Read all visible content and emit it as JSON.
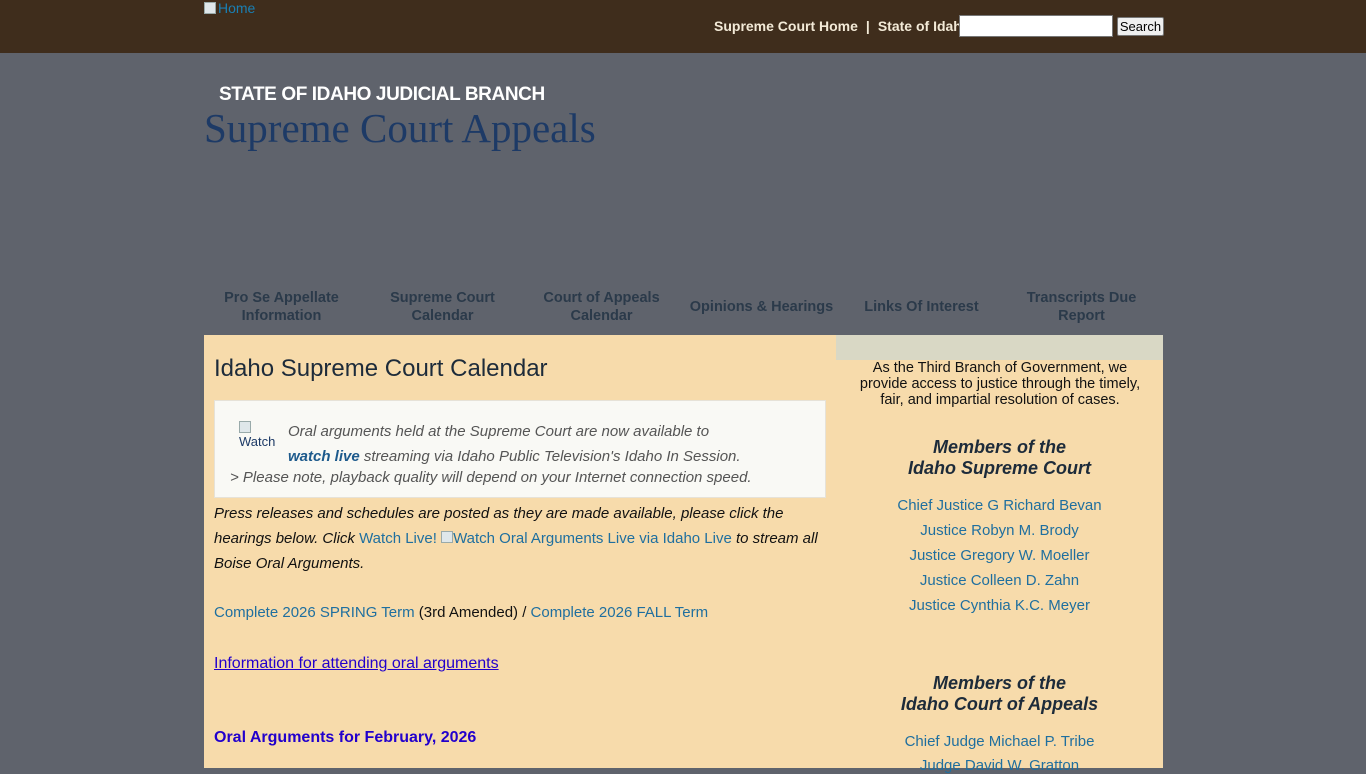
{
  "header": {
    "home_alt": "Home",
    "links": [
      "Supreme Court Home",
      "State of Idaho"
    ],
    "separator": "|",
    "search_placeholder": "",
    "search_button": "Search"
  },
  "banner": {
    "branch": "STATE OF IDAHO JUDICIAL BRANCH",
    "title": "Supreme Court Appeals"
  },
  "nav": [
    "Pro Se Appellate Information",
    "Supreme Court Calendar",
    "Court of Appeals Calendar",
    "Opinions & Hearings",
    "Links Of Interest",
    "Transcripts Due Report"
  ],
  "main": {
    "page_title": "Idaho Supreme Court Calendar",
    "live_box": {
      "img_alt": "Watch",
      "text1": "Oral arguments held at the Supreme Court are now available to",
      "watch_link": "watch live",
      "text2": " streaming via Idaho Public Television's Idaho In Session.",
      "note": "> Please note, playback quality will depend on your Internet connection speed."
    },
    "press": {
      "text1": "Press releases and schedules are posted as they are made available, please click the hearings below. Click ",
      "watch_live_link": "Watch Live!",
      "img_alt": "Watch Oral Arguments Live via Idaho Live",
      "text2": " to stream all Boise Oral Arguments."
    },
    "terms": {
      "spring": "Complete 2026 SPRING Term",
      "spring_note": " (3rd Amended) / ",
      "fall": "Complete 2026 FALL Term"
    },
    "attend_link": "Information for attending oral arguments",
    "oral_feb": "Oral Arguments for February, 2026"
  },
  "sidebar": {
    "tagline": "As the Third Branch of Government, we provide access to justice through the timely, fair, and impartial resolution of cases.",
    "supreme_heading": [
      "Members of the",
      "Idaho Supreme Court"
    ],
    "supreme_members": [
      "Chief Justice G Richard Bevan",
      "Justice Robyn M. Brody",
      "Justice Gregory W. Moeller",
      "Justice Colleen D. Zahn",
      "Justice Cynthia K.C. Meyer"
    ],
    "appeals_heading": [
      "Members of the",
      "Idaho Court of Appeals"
    ],
    "appeals_members": [
      "Chief Judge Michael P. Tribe",
      "Judge David W. Gratton"
    ]
  }
}
